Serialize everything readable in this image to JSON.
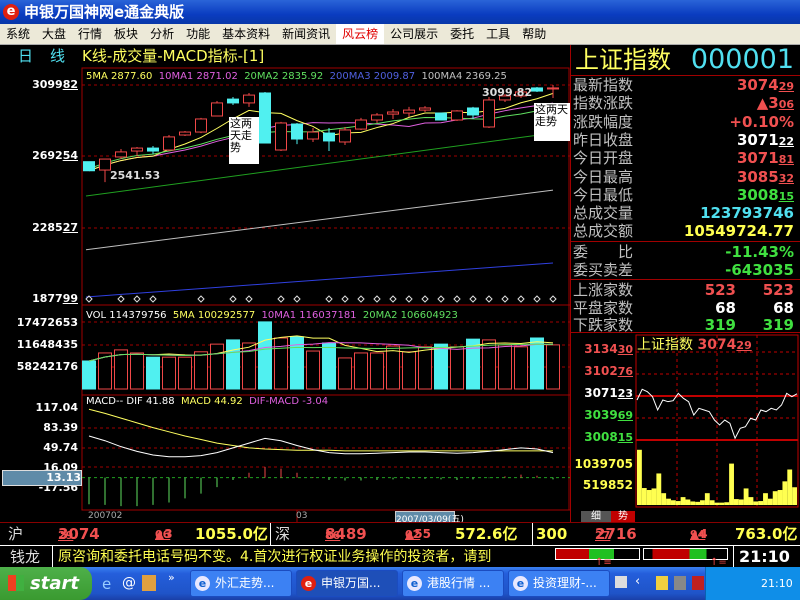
{
  "window": {
    "title": "申银万国神网e通金典版",
    "icon": "e"
  },
  "menu": [
    "系统",
    "大盘",
    "行情",
    "板块",
    "分析",
    "功能",
    "基本资料",
    "新闻资讯",
    "风云榜",
    "公司展示",
    "委托",
    "工具",
    "帮助"
  ],
  "menu_active": "风云榜",
  "chart_header": {
    "period": "日",
    "period2": "线",
    "title": "K线-成交量-MACD指标-[1]"
  },
  "price_axis": [
    {
      "i": "3099",
      "d": "82"
    },
    {
      "i": "2692",
      "d": "54"
    },
    {
      "i": "2285",
      "d": "27"
    },
    {
      "i": "1877",
      "d": "99"
    }
  ],
  "ma_legend": {
    "ma5": "5MA 2877.60",
    "ma10": "10MA1 2871.02",
    "ma20": "20MA2 2835.92",
    "ma200": "200MA3 2009.87",
    "ma100": "100MA4 2369.25"
  },
  "annotations": {
    "high": "3099.82",
    "low": "2541.53",
    "note1": "这两天走势",
    "note2": "这两天走势"
  },
  "candles": [
    [
      2660,
      2660,
      2608,
      2608
    ],
    [
      2612,
      2675,
      2543,
      2675
    ],
    [
      2687,
      2733,
      2675,
      2716
    ],
    [
      2721,
      2744,
      2693,
      2738
    ],
    [
      2738,
      2750,
      2704,
      2721
    ],
    [
      2727,
      2813,
      2721,
      2802
    ],
    [
      2813,
      2836,
      2807,
      2830
    ],
    [
      2830,
      2911,
      2824,
      2905
    ],
    [
      2922,
      3008,
      2922,
      2997
    ],
    [
      3019,
      3031,
      2985,
      2997
    ],
    [
      2997,
      3054,
      2974,
      3042
    ],
    [
      3054,
      3060,
      2767,
      2767
    ],
    [
      2727,
      2888,
      2721,
      2882
    ],
    [
      2876,
      2882,
      2761,
      2790
    ],
    [
      2790,
      2853,
      2773,
      2830
    ],
    [
      2824,
      2853,
      2721,
      2779
    ],
    [
      2773,
      2859,
      2756,
      2842
    ],
    [
      2847,
      2911,
      2842,
      2899
    ],
    [
      2899,
      2939,
      2882,
      2928
    ],
    [
      2933,
      2962,
      2905,
      2945
    ],
    [
      2939,
      2974,
      2916,
      2956
    ],
    [
      2956,
      2979,
      2945,
      2968
    ],
    [
      2939,
      2939,
      2899,
      2899
    ],
    [
      2899,
      2956,
      2893,
      2951
    ],
    [
      2968,
      2974,
      2905,
      2928
    ],
    [
      2859,
      3031,
      2853,
      3014
    ],
    [
      3014,
      3048,
      3002,
      3037
    ],
    [
      3037,
      3071,
      3025,
      3060
    ],
    [
      3083,
      3088,
      3060,
      3065
    ],
    [
      3077,
      3099.82,
      3025,
      3083
    ]
  ],
  "ma_long": {
    "ma20": [
      2463,
      2824
    ],
    "ma100": [
      2155,
      2497
    ],
    "ma200": [
      1884,
      2079
    ]
  },
  "markers": [
    0,
    2,
    3,
    4,
    7,
    9,
    10,
    12,
    13,
    15,
    16,
    17,
    18,
    19,
    20,
    21,
    22,
    23,
    24,
    25,
    26,
    27,
    28,
    29
  ],
  "volume_axis": [
    "17472653",
    "11648435",
    "58242176"
  ],
  "volume_legend": {
    "vol": "VOL 114379756",
    "ma5": "5MA 100292577",
    "ma10": "10MA1 116037181",
    "ma20": "20MA2 106604923"
  },
  "volumes_m": [
    7.3,
    9.4,
    10.2,
    9.4,
    8.3,
    8.3,
    8.3,
    9.7,
    11.7,
    12.8,
    12.0,
    17.5,
    13.3,
    13.6,
    9.9,
    12.0,
    8.1,
    9.4,
    9.4,
    11.2,
    9.7,
    11.0,
    11.7,
    11.0,
    13.0,
    12.8,
    11.5,
    11.0,
    13.3,
    11.5
  ],
  "macd_axis": [
    "117.04",
    "83.39",
    "49.74",
    "16.09",
    "-17.56"
  ],
  "macd_cursor": "13.13",
  "macd_legend": {
    "dif": "MACD-- DIF 41.88",
    "macd": "MACD 44.92",
    "diff": "DIF-MACD -3.04"
  },
  "dif": [
    70,
    62,
    52,
    44,
    38,
    35,
    35,
    37,
    42,
    50,
    58,
    66,
    62,
    54,
    47,
    42,
    40,
    40,
    41,
    42,
    43,
    43,
    42,
    41,
    42,
    44,
    47,
    50,
    48,
    41.88
  ],
  "dea": [
    115,
    108,
    100,
    92,
    84,
    77,
    70,
    64,
    58,
    54,
    50,
    48,
    47,
    46,
    46,
    46,
    45,
    45,
    45,
    45,
    45,
    45,
    45,
    45,
    45,
    45,
    45,
    45,
    45,
    44.92
  ],
  "date_axis": {
    "start": "200702",
    "mid": "03",
    "cursor": "2007/03/09(五)"
  },
  "quote": {
    "name": "上证指数",
    "code": "000001",
    "rows": [
      {
        "label": "最新指数",
        "i": "3074",
        "d": "29",
        "c": "red"
      },
      {
        "label": "指数涨跌",
        "i": "▲3",
        "d": "06",
        "c": "red"
      },
      {
        "label": "涨跌幅度",
        "i": "+0.10%",
        "d": "",
        "c": "red"
      },
      {
        "label": "昨日收盘",
        "i": "3071",
        "d": "22",
        "c": "wht"
      },
      {
        "label": "今日开盘",
        "i": "3071",
        "d": "81",
        "c": "red"
      },
      {
        "label": "今日最高",
        "i": "3085",
        "d": "32",
        "c": "red"
      },
      {
        "label": "今日最低",
        "i": "3008",
        "d": "15",
        "c": "grn"
      },
      {
        "label": "总成交量",
        "i": "123793746",
        "d": "",
        "c": "cyn"
      },
      {
        "label": "总成交额",
        "i": "10549724.77",
        "d": "",
        "c": "yel"
      }
    ],
    "ratio": [
      {
        "label": "委　　比",
        "v": "-11.43%"
      },
      {
        "label": "委买卖差",
        "v": "-643035"
      }
    ],
    "breadth": [
      {
        "label": "上涨家数",
        "a": "523",
        "b": "523",
        "c": "red"
      },
      {
        "label": "平盘家数",
        "a": "68",
        "b": "68",
        "c": "wht"
      },
      {
        "label": "下跌家数",
        "a": "319",
        "b": "319",
        "c": "grn"
      }
    ]
  },
  "intraday": {
    "title": "上证指数",
    "last_i": "3074",
    "last_d": "29",
    "axis": [
      {
        "i": "3134",
        "d": "30",
        "c": "red"
      },
      {
        "i": "3102",
        "d": "76",
        "c": "red"
      },
      {
        "i": "3071",
        "d": "23",
        "c": "wht"
      },
      {
        "i": "3039",
        "d": "69",
        "c": "grn"
      },
      {
        "i": "3008",
        "d": "15",
        "c": "grn"
      }
    ],
    "vol_axis": [
      "1039705",
      "519852"
    ],
    "prices": [
      3065.5,
      3080.8,
      3077.4,
      3070.3,
      3051.2,
      3065.5,
      3063.1,
      3064.5,
      3075.0,
      3067.9,
      3063.1,
      3044.0,
      3053.6,
      3051.2,
      3048.8,
      3036.8,
      3029.7,
      3036.8,
      3032.1,
      3010.6,
      3024.9,
      3027.2,
      3039.2,
      3036.8,
      3051.2,
      3048.8,
      3053.6,
      3051.2,
      3058.3,
      3075.0,
      3070.3,
      3074.29
    ],
    "volumes_k": [
      1400,
      430,
      380,
      420,
      800,
      300,
      160,
      120,
      100,
      200,
      140,
      90,
      80,
      120,
      300,
      120,
      60,
      60,
      70,
      1050,
      150,
      140,
      420,
      200,
      90,
      100,
      300,
      160,
      350,
      380,
      600,
      900,
      450
    ],
    "tabs": [
      "细",
      "势"
    ]
  },
  "status": {
    "sh": "沪",
    "sh_i": "3074",
    "sh_d": "29",
    "sh_chg_i": "▲3",
    "sh_chg_d": "06",
    "sh_amt": "1055.0亿",
    "sz": "深",
    "sz_i": "8489",
    "sz_d": "86",
    "sz_chg_i": "▲55",
    "sz_chg_d": "02",
    "sz_amt": "572.6亿",
    "hs": "300",
    "hs_i": "2716",
    "hs_d": "27",
    "hs_chg_i": "▲4",
    "hs_chg_d": "94",
    "hs_amt": "763.0亿"
  },
  "ticker": {
    "label": "钱龙",
    "text": "原咨询和委托电话号码不变。4.首次进行权证业务操作的投资者，请到",
    "time": "21:10"
  },
  "taskbar": {
    "start": "start",
    "tasks": [
      "外汇走势...",
      "申银万国...",
      "港股行情 ...",
      "投资理财-..."
    ],
    "clock": "21:10"
  },
  "colors": {
    "up": "#f04848",
    "down": "#50f0f0",
    "grid": "#a00000"
  }
}
